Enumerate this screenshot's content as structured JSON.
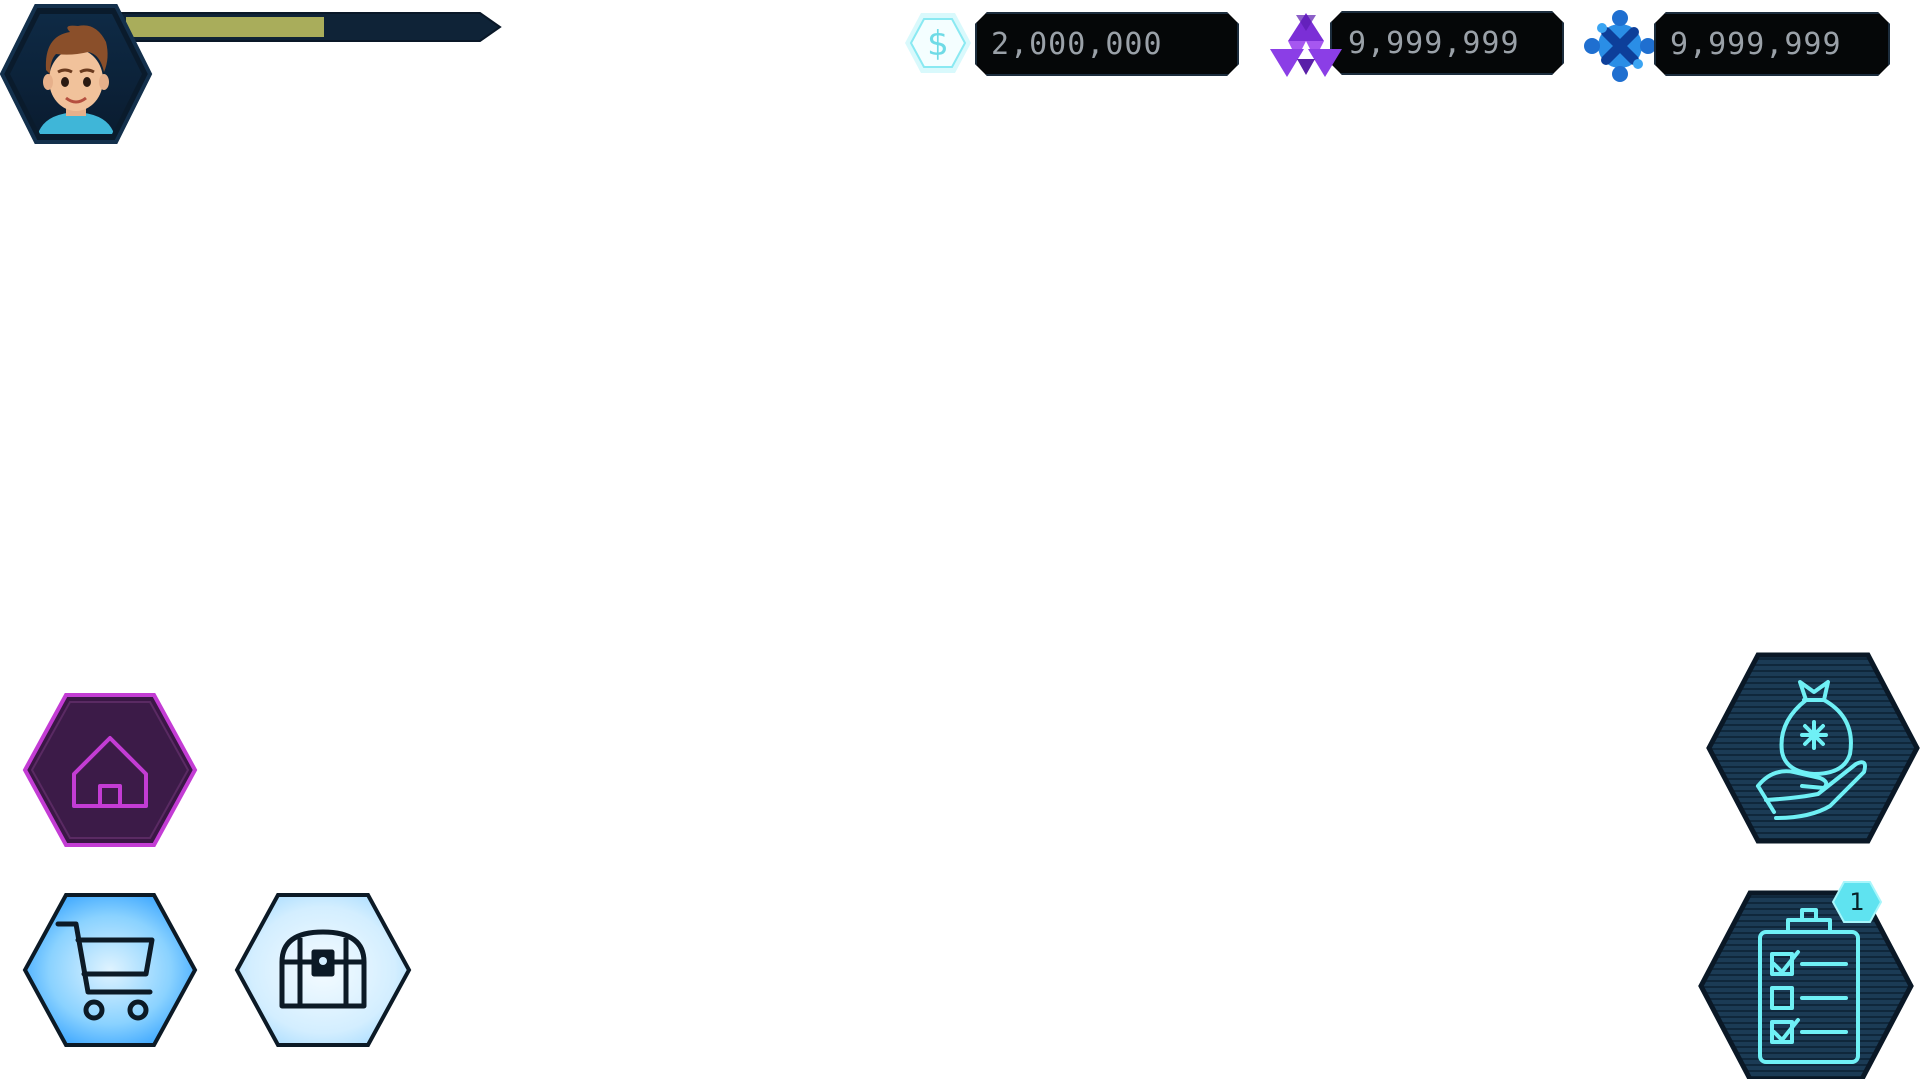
{
  "player": {
    "avatar_icon": "player-avatar",
    "xp_progress": 0.56,
    "xp_bar_fill_color": "#a9ad5b",
    "xp_bar_track_color": "#0f2337"
  },
  "currencies": [
    {
      "name": "cash",
      "icon": "dollar-coin-icon",
      "value": "2,000,000",
      "color": "#7fe8f2"
    },
    {
      "name": "purple-gems",
      "icon": "purple-triangle-gem-icon",
      "value": "9,999,999",
      "color": "#8a3ee0"
    },
    {
      "name": "blue-tokens",
      "icon": "blue-cross-token-icon",
      "value": "9,999,999",
      "color": "#1f7fd6"
    }
  ],
  "nav": {
    "home": {
      "icon": "home-icon",
      "color": "#c33cd4",
      "active": true
    },
    "shop": {
      "icon": "shopping-cart-icon",
      "color": "#48b8ff"
    },
    "inventory": {
      "icon": "treasure-chest-icon",
      "color": "#d3eeff"
    }
  },
  "side_actions": {
    "rewards": {
      "icon": "money-bag-hand-icon",
      "color": "#6ff0f5"
    },
    "quests": {
      "icon": "clipboard-checklist-icon",
      "color": "#6ff0f5",
      "badge": "1"
    }
  }
}
